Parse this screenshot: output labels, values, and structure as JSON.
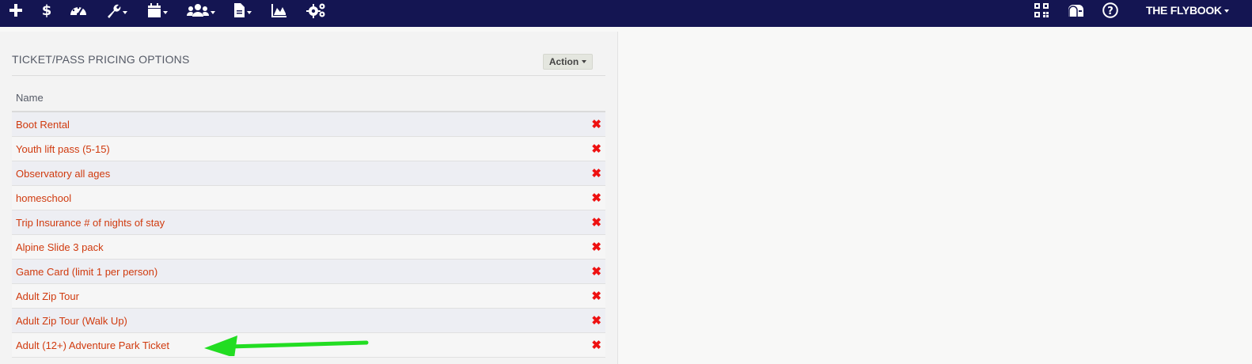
{
  "nav": {
    "icons": [
      "plus-icon",
      "dollar-icon",
      "dashboard-icon",
      "wrench-icon",
      "calendar-icon",
      "users-icon",
      "document-icon",
      "area-chart-icon",
      "gears-icon",
      "qr-code-icon",
      "mailbox-icon",
      "help-icon"
    ],
    "brand": "THE FLYBOOK"
  },
  "panel": {
    "title": "TICKET/PASS PRICING OPTIONS",
    "action_label": "Action",
    "column_header": "Name",
    "rows": [
      {
        "name": "Boot Rental"
      },
      {
        "name": "Youth lift pass (5-15)"
      },
      {
        "name": "Observatory all ages"
      },
      {
        "name": "homeschool"
      },
      {
        "name": "Trip Insurance # of nights of stay"
      },
      {
        "name": "Alpine Slide 3 pack"
      },
      {
        "name": "Game Card (limit 1 per person)"
      },
      {
        "name": "Adult Zip Tour"
      },
      {
        "name": "Adult Zip Tour (Walk Up)"
      },
      {
        "name": "Adult (12+) Adventure Park Ticket"
      }
    ],
    "delete_glyph": "✖"
  },
  "colors": {
    "nav_bg": "#141552",
    "link": "#d03a0e",
    "delete": "#ee1111",
    "annotation_arrow": "#22dd22"
  }
}
